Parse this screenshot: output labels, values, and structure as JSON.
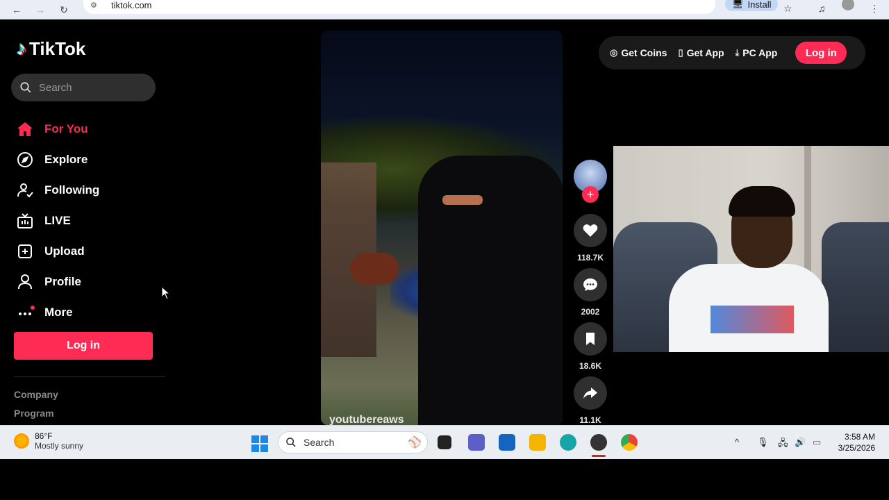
{
  "browser": {
    "url": "tiktok.com",
    "install_label": "Install"
  },
  "sidebar": {
    "logo_text": "TikTok",
    "search_placeholder": "Search",
    "items": [
      {
        "label": "For You",
        "icon": "home-icon"
      },
      {
        "label": "Explore",
        "icon": "compass-icon"
      },
      {
        "label": "Following",
        "icon": "following-icon"
      },
      {
        "label": "LIVE",
        "icon": "live-icon"
      },
      {
        "label": "Upload",
        "icon": "upload-icon"
      },
      {
        "label": "Profile",
        "icon": "profile-icon"
      },
      {
        "label": "More",
        "icon": "more-icon"
      }
    ],
    "login_label": "Log in",
    "footer": [
      "Company",
      "Program"
    ]
  },
  "header": {
    "get_coins": "Get Coins",
    "get_app": "Get App",
    "pc_app": "PC App",
    "login_label": "Log in"
  },
  "video": {
    "watermark": "youtubereaws"
  },
  "actions": {
    "likes": "118.7K",
    "comments": "2002",
    "saves": "18.6K",
    "shares": "11.1K"
  },
  "taskbar": {
    "temperature": "86°F",
    "weather": "Mostly sunny",
    "search_placeholder": "Search",
    "time": "3:58 AM",
    "date": "3/25/2026"
  },
  "colors": {
    "accent": "#fe2c55",
    "background": "#000000"
  }
}
